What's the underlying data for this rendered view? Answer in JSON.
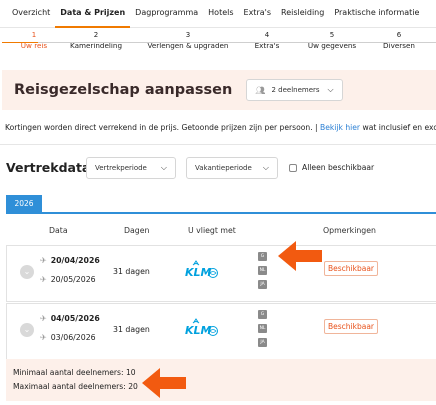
{
  "nav": {
    "items": [
      "Overzicht",
      "Data & Prijzen",
      "Dagprogramma",
      "Hotels",
      "Extra's",
      "Reisleiding",
      "Praktische informatie"
    ],
    "active_index": 1
  },
  "steps": [
    {
      "num": "1",
      "label": "Uw reis"
    },
    {
      "num": "2",
      "label": "Kamerindeling"
    },
    {
      "num": "3",
      "label": "Verlengen & upgraden"
    },
    {
      "num": "4",
      "label": "Extra's"
    },
    {
      "num": "5",
      "label": "Uw gegevens"
    },
    {
      "num": "6",
      "label": "Diversen"
    }
  ],
  "banner": {
    "title": "Reisgezelschap aanpassen",
    "participants": "2 deelnemers"
  },
  "note": {
    "text": "Kortingen worden direct verrekend in de prijs. Getoonde prijzen zijn per persoon. |",
    "link": "Bekijk hier",
    "rest": "wat inclusief en exclus"
  },
  "filters": {
    "title": "Vertrekdata",
    "period1": "Vertrekperiode",
    "period2": "Vakantieperiode",
    "available_only": "Alleen beschikbaar"
  },
  "year_tab": "2026",
  "table": {
    "headers": {
      "date": "Data",
      "days": "Dagen",
      "airline": "U vliegt met",
      "remarks": "Opmerkingen"
    },
    "rows": [
      {
        "depart": "20/04/2026",
        "return": "20/05/2026",
        "days": "31 dagen",
        "airline": "KLM",
        "classes": [
          "G",
          "NL",
          "JA"
        ],
        "status": "Beschikbaar"
      },
      {
        "depart": "04/05/2026",
        "return": "03/06/2026",
        "days": "31 dagen",
        "airline": "KLM",
        "classes": [
          "G",
          "NL",
          "JA"
        ],
        "status": "Beschikbaar"
      }
    ]
  },
  "footer": {
    "min": "Minimaal aantal deelnemers: 10",
    "max": "Maximaal aantal deelnemers: 20"
  },
  "colors": {
    "accent": "#f07a00",
    "tab_blue": "#2f8fd8",
    "arrow": "#f25a10",
    "klm_blue": "#00a1de"
  },
  "icons": [
    "people-icon",
    "chevron-down-icon",
    "plane-depart-icon",
    "plane-return-icon",
    "expand-icon",
    "klm-logo",
    "skyteam-icon",
    "arrow-pointer-icon"
  ]
}
